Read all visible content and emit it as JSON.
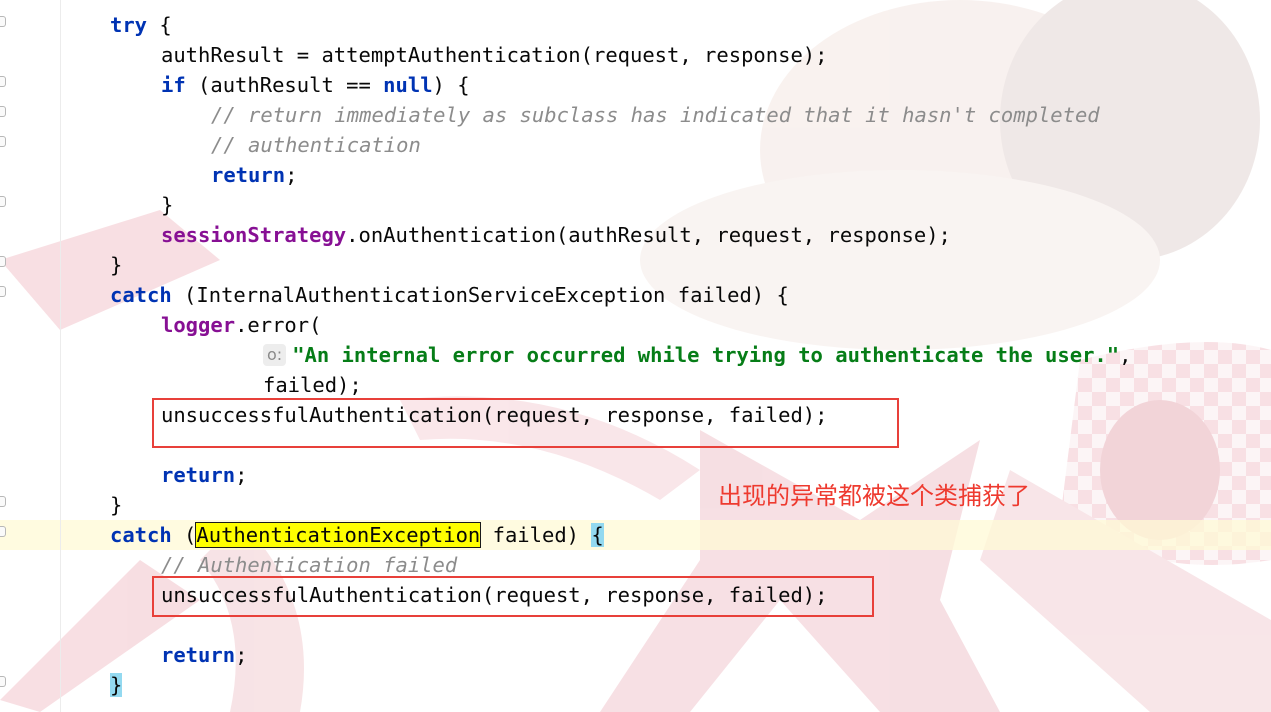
{
  "editor": {
    "lines": [
      {
        "indent": 1,
        "tokens": [
          {
            "t": "try",
            "c": "kw"
          },
          {
            "t": " {",
            "c": ""
          }
        ]
      },
      {
        "indent": 2,
        "tokens": [
          {
            "t": "authResult = attemptAuthentication(request, response);",
            "c": ""
          }
        ]
      },
      {
        "indent": 2,
        "tokens": [
          {
            "t": "if",
            "c": "kw"
          },
          {
            "t": " (authResult == ",
            "c": ""
          },
          {
            "t": "null",
            "c": "kw"
          },
          {
            "t": ") {",
            "c": ""
          }
        ]
      },
      {
        "indent": 3,
        "tokens": [
          {
            "t": "// return immediately as subclass has indicated that it hasn't completed",
            "c": "cm"
          }
        ]
      },
      {
        "indent": 3,
        "tokens": [
          {
            "t": "// authentication",
            "c": "cm"
          }
        ]
      },
      {
        "indent": 3,
        "tokens": [
          {
            "t": "return",
            "c": "kw"
          },
          {
            "t": ";",
            "c": ""
          }
        ]
      },
      {
        "indent": 2,
        "tokens": [
          {
            "t": "}",
            "c": ""
          }
        ]
      },
      {
        "indent": 2,
        "tokens": [
          {
            "t": "sessionStrategy",
            "c": "fld"
          },
          {
            "t": ".onAuthentication(authResult, request, response);",
            "c": ""
          }
        ]
      },
      {
        "indent": 1,
        "tokens": [
          {
            "t": "}",
            "c": ""
          }
        ]
      },
      {
        "indent": 1,
        "tokens": [
          {
            "t": "catch",
            "c": "kw"
          },
          {
            "t": " (InternalAuthenticationServiceException failed) {",
            "c": ""
          }
        ]
      },
      {
        "indent": 2,
        "tokens": [
          {
            "t": "logger",
            "c": "fld"
          },
          {
            "t": ".error(",
            "c": ""
          }
        ]
      },
      {
        "indent": 4,
        "tokens": [
          {
            "t": "o:",
            "c": "hint"
          },
          {
            "t": "\"An internal error occurred while trying to authenticate the user.\"",
            "c": "st"
          },
          {
            "t": ",",
            "c": ""
          }
        ]
      },
      {
        "indent": 4,
        "tokens": [
          {
            "t": "failed);",
            "c": ""
          }
        ]
      },
      {
        "indent": 2,
        "tokens": [
          {
            "t": "unsuccessfulAuthentication(request, response, failed);",
            "c": ""
          }
        ]
      },
      {
        "indent": 0,
        "tokens": []
      },
      {
        "indent": 2,
        "tokens": [
          {
            "t": "return",
            "c": "kw"
          },
          {
            "t": ";",
            "c": ""
          }
        ]
      },
      {
        "indent": 1,
        "tokens": [
          {
            "t": "}",
            "c": ""
          }
        ]
      },
      {
        "indent": 1,
        "tokens": [
          {
            "t": "catch",
            "c": "kw"
          },
          {
            "t": " (",
            "c": ""
          },
          {
            "t": "AuthenticationException",
            "c": "hl-yellow"
          },
          {
            "t": " failed) ",
            "c": ""
          },
          {
            "t": "{",
            "c": "brace-hl"
          }
        ]
      },
      {
        "indent": 2,
        "tokens": [
          {
            "t": "// Authentication failed",
            "c": "cm"
          }
        ]
      },
      {
        "indent": 2,
        "tokens": [
          {
            "t": "unsuccessfulAuthentication(request, response, failed);",
            "c": ""
          }
        ]
      },
      {
        "indent": 0,
        "tokens": []
      },
      {
        "indent": 2,
        "tokens": [
          {
            "t": "return",
            "c": "kw"
          },
          {
            "t": ";",
            "c": ""
          }
        ]
      },
      {
        "indent": 1,
        "tokens": [
          {
            "t": "}",
            "c": "brace-hl"
          }
        ]
      }
    ],
    "caret_line_index": 17
  },
  "annotation": {
    "text": "出现的异常都被这个类捕获了",
    "color": "#ee3a2f"
  },
  "highlight_boxes": [
    {
      "name": "first-unsuccessful-call-box",
      "line_index": 13
    },
    {
      "name": "second-unsuccessful-call-box",
      "line_index": 19
    }
  ],
  "colors": {
    "keyword": "#0033b3",
    "comment": "#8c8c8c",
    "string": "#067d17",
    "field": "#871094",
    "box": "#e8403a"
  }
}
